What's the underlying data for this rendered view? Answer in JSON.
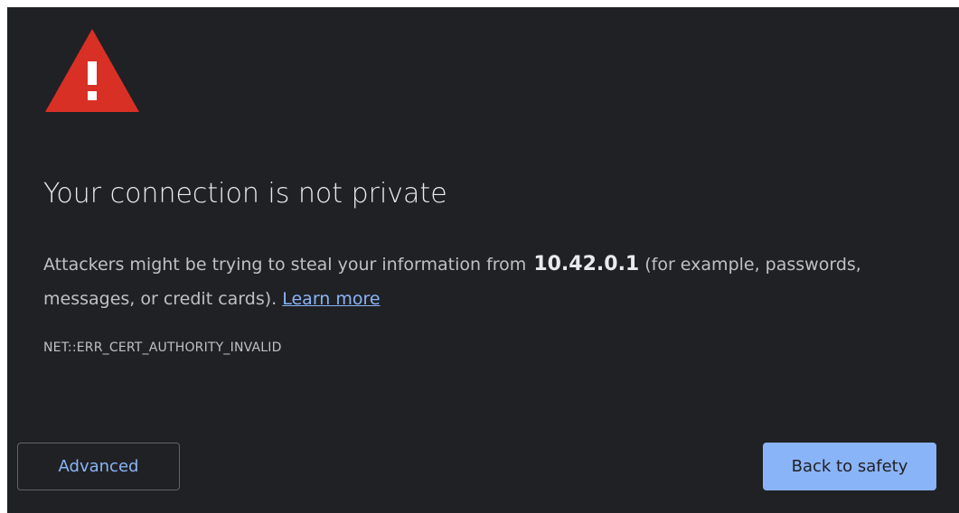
{
  "interstitial": {
    "icon": "warning-triangle-icon",
    "icon_color": "#d93025",
    "headline": "Your connection is not private",
    "body_before": "Attackers might be trying to steal your information from",
    "host": "10.42.0.1",
    "body_after": "(for example, passwords, messages, or credit cards).",
    "learn_more": "Learn more",
    "error_code": "NET::ERR_CERT_AUTHORITY_INVALID"
  },
  "buttons": {
    "advanced_label": "Advanced",
    "back_label": "Back to safety"
  },
  "colors": {
    "background": "#202124",
    "accent": "#8ab4f8",
    "text": "#e8eaed",
    "secondary_text": "#bdc1c6"
  }
}
